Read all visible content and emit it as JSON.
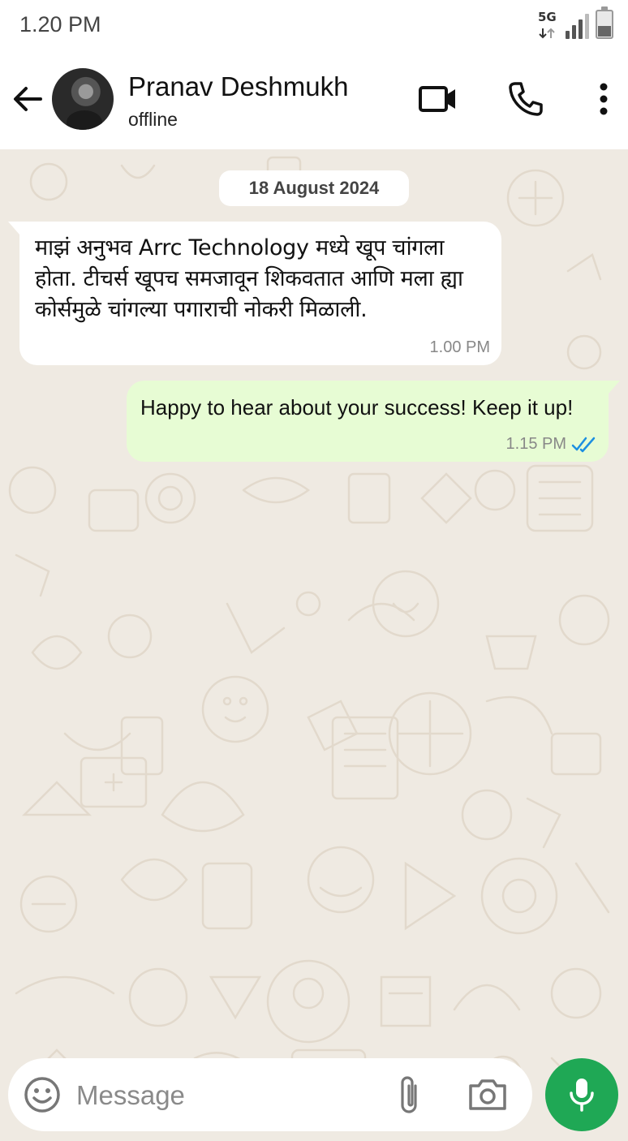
{
  "status_bar": {
    "time": "1.20 PM",
    "network": "5G",
    "icons": [
      "network-arrows-icon",
      "signal-icon",
      "battery-icon"
    ]
  },
  "header": {
    "contact_name": "Pranav Deshmukh",
    "contact_status": "offline",
    "icons": [
      "back-arrow-icon",
      "avatar",
      "video-call-icon",
      "phone-icon",
      "more-vert-icon"
    ]
  },
  "chat": {
    "date_chip": "18 August 2024",
    "messages": [
      {
        "direction": "incoming",
        "text": "माझं अनुभव Arrc Technology मध्ये खूप चांगला होता. टीचर्स खूपच समजावून शिकवतात आणि मला ह्या कोर्समुळे चांगल्या पगाराची नोकरी मिळाली.",
        "time": "1.00 PM"
      },
      {
        "direction": "outgoing",
        "text": "Happy to hear about your success! Keep it up!",
        "time": "1.15 PM",
        "status_icon": "double-check-icon",
        "status_color": "#1d8fe1"
      }
    ]
  },
  "composer": {
    "placeholder": "Message",
    "value": "",
    "icons": [
      "emoji-icon",
      "attach-icon",
      "camera-icon",
      "mic-icon"
    ],
    "mic_color": "#1fa855"
  },
  "colors": {
    "chat_background": "#efeae2",
    "outgoing_bubble": "#e7fcd4",
    "incoming_bubble": "#ffffff"
  }
}
